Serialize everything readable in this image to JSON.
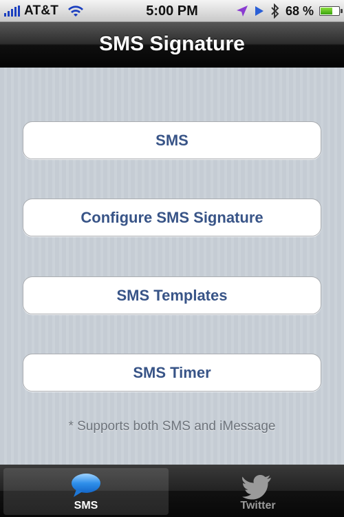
{
  "status_bar": {
    "carrier": "AT&T",
    "time": "5:00 PM",
    "battery_percent": "68 %",
    "battery_level": 0.68,
    "icons": [
      "signal-icon",
      "wifi-icon",
      "location-icon",
      "play-icon",
      "bluetooth-icon",
      "battery-icon"
    ]
  },
  "nav": {
    "title": "SMS Signature"
  },
  "menu": {
    "items": [
      {
        "label": "SMS"
      },
      {
        "label": "Configure SMS Signature"
      },
      {
        "label": "SMS Templates"
      },
      {
        "label": "SMS Timer"
      }
    ],
    "footnote": "* Supports both SMS and iMessage"
  },
  "tabs": [
    {
      "label": "SMS",
      "icon": "speech-bubble-icon",
      "selected": true
    },
    {
      "label": "Twitter",
      "icon": "twitter-bird-icon",
      "selected": false
    }
  ],
  "colors": {
    "button_text": "#385487",
    "background_stripes": "#c5ccd4",
    "signal": "#1b3fbf",
    "battery_fill": "#5cc022"
  }
}
